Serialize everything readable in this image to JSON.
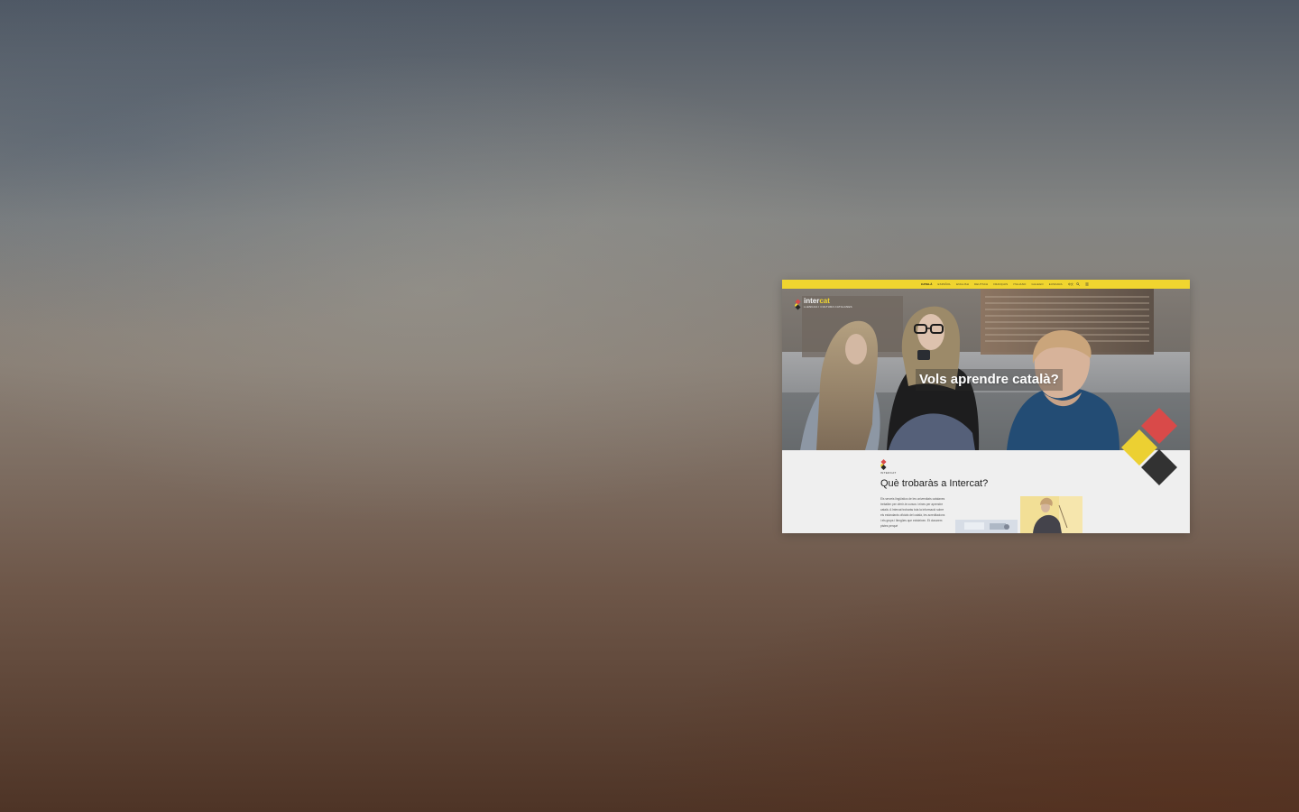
{
  "preview": {
    "languages": [
      "CATALÀ",
      "ESPAÑOL",
      "ENGLISH",
      "DEUTSCH",
      "FRANÇAIS",
      "ITALIANO",
      "GALEGO",
      "EUSKARA",
      "中文"
    ],
    "active_language": "CATALÀ",
    "toolbar_icons": [
      "search-icon",
      "menu-icon"
    ],
    "logo": {
      "prefix": "inter",
      "highlight": "cat",
      "subtitle": "LLENGUA I CULTURA CATALANES"
    },
    "hero": {
      "heading": "Vols aprendre català?"
    },
    "section": {
      "kicker": "INTERCAT",
      "title": "Què trobaràs a Intercat?",
      "body": "Els serveis lingüístics de les universitats catalanes treballen per oferir-te cursos i eines per aprendre català. A Intercat trobaràs tota la informació sobre els estàndards oficials del català, les acreditacions i els grups i llengües que existeixen. Et donarem pistes perquè"
    },
    "colors": {
      "accent": "#f0d52f",
      "red": "#d94a49",
      "yellow": "#ecd032",
      "dark": "#323232",
      "background": "#efefef"
    }
  }
}
